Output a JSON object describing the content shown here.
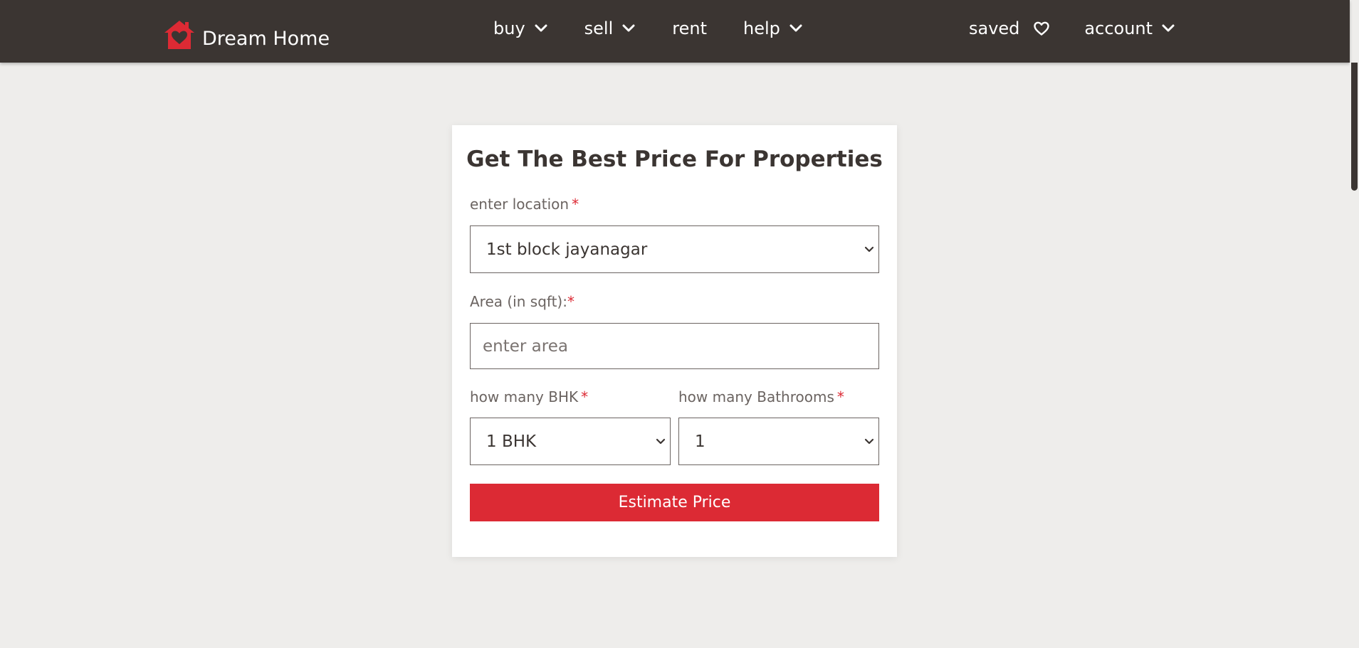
{
  "brand": {
    "name": "Dream Home",
    "logo_icon": "house-heart-icon",
    "accent_color": "#dc2a34",
    "header_color": "#3b3532"
  },
  "nav": {
    "main": [
      {
        "label": "buy",
        "icon": "chevron-down-icon"
      },
      {
        "label": "sell",
        "icon": "chevron-down-icon"
      },
      {
        "label": "rent"
      },
      {
        "label": "help",
        "icon": "chevron-down-icon"
      }
    ],
    "right": [
      {
        "label": "saved",
        "icon": "heart-outline-icon"
      },
      {
        "label": "account",
        "icon": "chevron-down-icon"
      }
    ]
  },
  "form": {
    "title": "Get The Best Price For Properties",
    "required_mark": "*",
    "location": {
      "label": "enter location",
      "selected": "1st block jayanagar"
    },
    "area": {
      "label": "Area (in sqft):",
      "placeholder": "enter area",
      "value": ""
    },
    "bhk": {
      "label": "how many BHK",
      "selected": "1 BHK"
    },
    "bathrooms": {
      "label": "how many Bathrooms",
      "selected": "1"
    },
    "submit_label": "Estimate Price"
  }
}
